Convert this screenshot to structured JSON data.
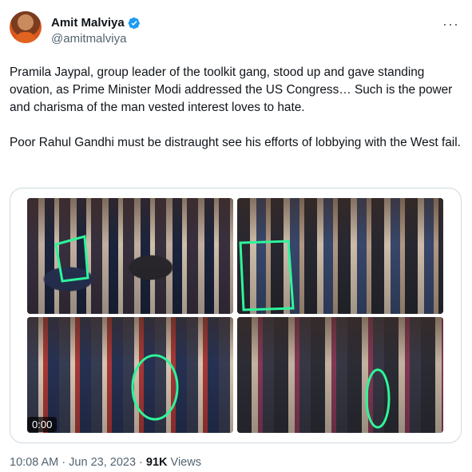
{
  "author": {
    "name": "Amit Malviya",
    "handle": "@amitmalviya"
  },
  "more_label": "···",
  "tweet": {
    "paragraph1": "Pramila Jaypal, group leader of the toolkit gang, stood up and gave standing ovation, as Prime Minister Modi addressed the US Congress… Such is the power and charisma of the man vested interest loves to hate.",
    "paragraph2": "Poor Rahul Gandhi must be distraught see his efforts of lobbying with the West fail."
  },
  "media": {
    "video_time": "0:00"
  },
  "meta": {
    "time": "10:08 AM",
    "separator": " · ",
    "date": "Jun 23, 2023",
    "views_count": "91K",
    "views_label": " Views"
  },
  "colors": {
    "verified": "#1d9bf0",
    "highlight": "#2ef59a"
  }
}
